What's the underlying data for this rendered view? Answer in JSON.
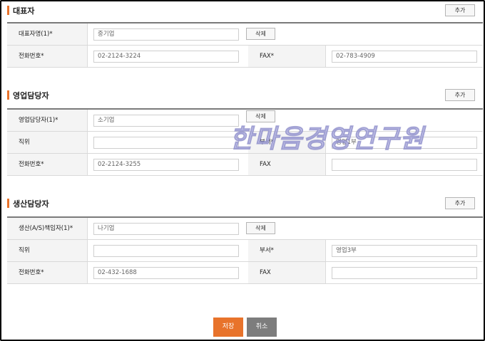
{
  "representative": {
    "title": "대표자",
    "add_label": "추가",
    "name_label": "대표자명(1)*",
    "name_value": "중기업",
    "delete_label": "삭제",
    "phone_label": "전화번호*",
    "phone_value": "02-2124-3224",
    "fax_label": "FAX*",
    "fax_value": "02-783-4909"
  },
  "sales_contact": {
    "title": "영업담당자",
    "add_label": "추가",
    "name_label": "영업담당자(1)*",
    "name_value": "소기업",
    "delete_label": "삭제",
    "position_label": "직위",
    "position_value": "",
    "dept_label": "부서*",
    "dept_value": "영업1부",
    "phone_label": "전화번호*",
    "phone_value": "02-2124-3255",
    "fax_label": "FAX",
    "fax_value": ""
  },
  "production_contact": {
    "title": "생산담당자",
    "add_label": "추가",
    "name_label": "생산(A/S)책임자(1)*",
    "name_value": "나기업",
    "delete_label": "삭제",
    "position_label": "직위",
    "position_value": "",
    "dept_label": "부서*",
    "dept_value": "영업3부",
    "phone_label": "전화번호*",
    "phone_value": "02-432-1688",
    "fax_label": "FAX",
    "fax_value": ""
  },
  "actions": {
    "save_label": "저장",
    "cancel_label": "취소"
  },
  "watermark": "한마음경영연구원",
  "colors": {
    "accent": "#e8732b",
    "cancel": "#7d7d7d",
    "label_bg": "#f4f4f4"
  }
}
